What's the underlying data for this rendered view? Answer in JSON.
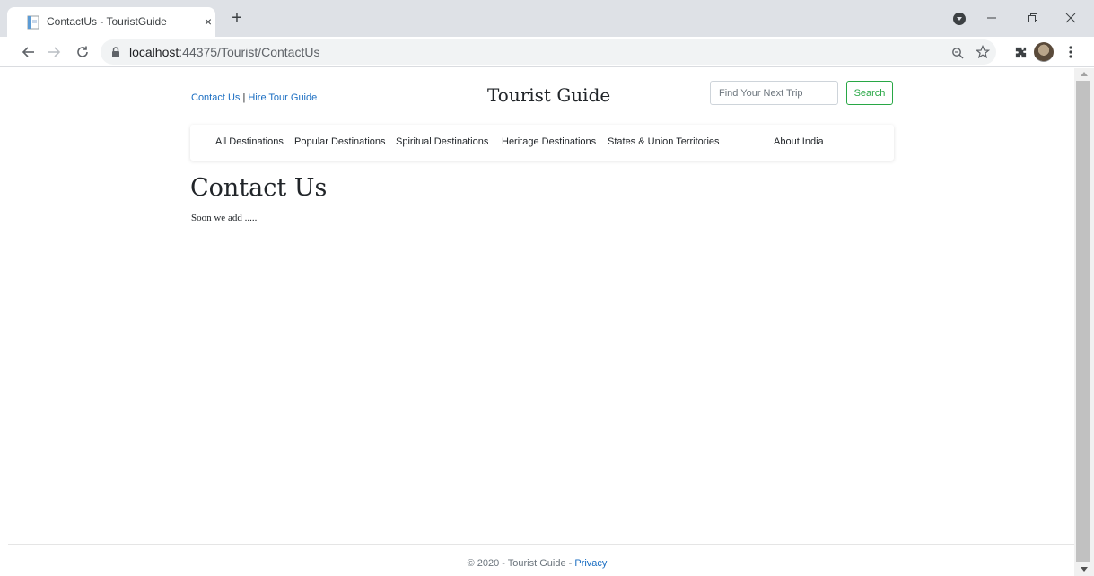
{
  "browser": {
    "tab_title": "ContactUs - TouristGuide",
    "tab_close_glyph": "×",
    "new_tab_glyph": "+",
    "url_host": "localhost",
    "url_rest": ":44375/Tourist/ContactUs",
    "icons": [
      "favicon-icon",
      "close-icon",
      "plus-icon",
      "back-arrow-icon",
      "forward-arrow-icon",
      "reload-icon",
      "lock-icon",
      "zoom-icon",
      "star-icon",
      "extensions-icon",
      "avatar",
      "menu-dots-icon",
      "minimize-icon",
      "restore-icon",
      "window-close-icon"
    ]
  },
  "header": {
    "contact_link": "Contact Us",
    "separator": " | ",
    "hire_link": "Hire Tour Guide",
    "site_title": "Tourist Guide",
    "search_placeholder": "Find Your Next Trip",
    "search_button": "Search"
  },
  "nav": {
    "items": [
      "All Destinations",
      "Popular Destinations",
      "Spiritual Destinations",
      "Heritage Destinations",
      "States & Union Territories",
      "About India"
    ]
  },
  "main": {
    "heading": "Contact Us",
    "body": "Soon we add ....."
  },
  "footer": {
    "text": "© 2020 - Tourist Guide - ",
    "privacy_link": "Privacy"
  },
  "colors": {
    "link": "#1b6ec2",
    "search_button": "#28a745",
    "tabstrip": "#dee1e6"
  }
}
